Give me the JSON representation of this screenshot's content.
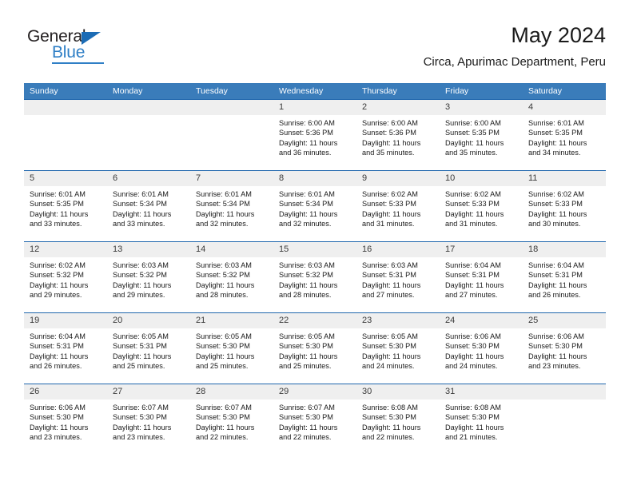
{
  "brand": {
    "name_top": "General",
    "name_bottom": "Blue",
    "triangle_color": "#1c6cb5",
    "blue_color": "#2f7fc6"
  },
  "header": {
    "title": "May 2024",
    "subtitle": "Circa, Apurimac Department, Peru"
  },
  "calendar": {
    "header_bg": "#3a7cba",
    "row_border_color": "#1f66ad",
    "date_band_bg": "#efefef",
    "weekdays": [
      "Sunday",
      "Monday",
      "Tuesday",
      "Wednesday",
      "Thursday",
      "Friday",
      "Saturday"
    ],
    "weeks": [
      [
        {
          "date": "",
          "lines": []
        },
        {
          "date": "",
          "lines": []
        },
        {
          "date": "",
          "lines": []
        },
        {
          "date": "1",
          "lines": [
            "Sunrise: 6:00 AM",
            "Sunset: 5:36 PM",
            "Daylight: 11 hours",
            "and 36 minutes."
          ]
        },
        {
          "date": "2",
          "lines": [
            "Sunrise: 6:00 AM",
            "Sunset: 5:36 PM",
            "Daylight: 11 hours",
            "and 35 minutes."
          ]
        },
        {
          "date": "3",
          "lines": [
            "Sunrise: 6:00 AM",
            "Sunset: 5:35 PM",
            "Daylight: 11 hours",
            "and 35 minutes."
          ]
        },
        {
          "date": "4",
          "lines": [
            "Sunrise: 6:01 AM",
            "Sunset: 5:35 PM",
            "Daylight: 11 hours",
            "and 34 minutes."
          ]
        }
      ],
      [
        {
          "date": "5",
          "lines": [
            "Sunrise: 6:01 AM",
            "Sunset: 5:35 PM",
            "Daylight: 11 hours",
            "and 33 minutes."
          ]
        },
        {
          "date": "6",
          "lines": [
            "Sunrise: 6:01 AM",
            "Sunset: 5:34 PM",
            "Daylight: 11 hours",
            "and 33 minutes."
          ]
        },
        {
          "date": "7",
          "lines": [
            "Sunrise: 6:01 AM",
            "Sunset: 5:34 PM",
            "Daylight: 11 hours",
            "and 32 minutes."
          ]
        },
        {
          "date": "8",
          "lines": [
            "Sunrise: 6:01 AM",
            "Sunset: 5:34 PM",
            "Daylight: 11 hours",
            "and 32 minutes."
          ]
        },
        {
          "date": "9",
          "lines": [
            "Sunrise: 6:02 AM",
            "Sunset: 5:33 PM",
            "Daylight: 11 hours",
            "and 31 minutes."
          ]
        },
        {
          "date": "10",
          "lines": [
            "Sunrise: 6:02 AM",
            "Sunset: 5:33 PM",
            "Daylight: 11 hours",
            "and 31 minutes."
          ]
        },
        {
          "date": "11",
          "lines": [
            "Sunrise: 6:02 AM",
            "Sunset: 5:33 PM",
            "Daylight: 11 hours",
            "and 30 minutes."
          ]
        }
      ],
      [
        {
          "date": "12",
          "lines": [
            "Sunrise: 6:02 AM",
            "Sunset: 5:32 PM",
            "Daylight: 11 hours",
            "and 29 minutes."
          ]
        },
        {
          "date": "13",
          "lines": [
            "Sunrise: 6:03 AM",
            "Sunset: 5:32 PM",
            "Daylight: 11 hours",
            "and 29 minutes."
          ]
        },
        {
          "date": "14",
          "lines": [
            "Sunrise: 6:03 AM",
            "Sunset: 5:32 PM",
            "Daylight: 11 hours",
            "and 28 minutes."
          ]
        },
        {
          "date": "15",
          "lines": [
            "Sunrise: 6:03 AM",
            "Sunset: 5:32 PM",
            "Daylight: 11 hours",
            "and 28 minutes."
          ]
        },
        {
          "date": "16",
          "lines": [
            "Sunrise: 6:03 AM",
            "Sunset: 5:31 PM",
            "Daylight: 11 hours",
            "and 27 minutes."
          ]
        },
        {
          "date": "17",
          "lines": [
            "Sunrise: 6:04 AM",
            "Sunset: 5:31 PM",
            "Daylight: 11 hours",
            "and 27 minutes."
          ]
        },
        {
          "date": "18",
          "lines": [
            "Sunrise: 6:04 AM",
            "Sunset: 5:31 PM",
            "Daylight: 11 hours",
            "and 26 minutes."
          ]
        }
      ],
      [
        {
          "date": "19",
          "lines": [
            "Sunrise: 6:04 AM",
            "Sunset: 5:31 PM",
            "Daylight: 11 hours",
            "and 26 minutes."
          ]
        },
        {
          "date": "20",
          "lines": [
            "Sunrise: 6:05 AM",
            "Sunset: 5:31 PM",
            "Daylight: 11 hours",
            "and 25 minutes."
          ]
        },
        {
          "date": "21",
          "lines": [
            "Sunrise: 6:05 AM",
            "Sunset: 5:30 PM",
            "Daylight: 11 hours",
            "and 25 minutes."
          ]
        },
        {
          "date": "22",
          "lines": [
            "Sunrise: 6:05 AM",
            "Sunset: 5:30 PM",
            "Daylight: 11 hours",
            "and 25 minutes."
          ]
        },
        {
          "date": "23",
          "lines": [
            "Sunrise: 6:05 AM",
            "Sunset: 5:30 PM",
            "Daylight: 11 hours",
            "and 24 minutes."
          ]
        },
        {
          "date": "24",
          "lines": [
            "Sunrise: 6:06 AM",
            "Sunset: 5:30 PM",
            "Daylight: 11 hours",
            "and 24 minutes."
          ]
        },
        {
          "date": "25",
          "lines": [
            "Sunrise: 6:06 AM",
            "Sunset: 5:30 PM",
            "Daylight: 11 hours",
            "and 23 minutes."
          ]
        }
      ],
      [
        {
          "date": "26",
          "lines": [
            "Sunrise: 6:06 AM",
            "Sunset: 5:30 PM",
            "Daylight: 11 hours",
            "and 23 minutes."
          ]
        },
        {
          "date": "27",
          "lines": [
            "Sunrise: 6:07 AM",
            "Sunset: 5:30 PM",
            "Daylight: 11 hours",
            "and 23 minutes."
          ]
        },
        {
          "date": "28",
          "lines": [
            "Sunrise: 6:07 AM",
            "Sunset: 5:30 PM",
            "Daylight: 11 hours",
            "and 22 minutes."
          ]
        },
        {
          "date": "29",
          "lines": [
            "Sunrise: 6:07 AM",
            "Sunset: 5:30 PM",
            "Daylight: 11 hours",
            "and 22 minutes."
          ]
        },
        {
          "date": "30",
          "lines": [
            "Sunrise: 6:08 AM",
            "Sunset: 5:30 PM",
            "Daylight: 11 hours",
            "and 22 minutes."
          ]
        },
        {
          "date": "31",
          "lines": [
            "Sunrise: 6:08 AM",
            "Sunset: 5:30 PM",
            "Daylight: 11 hours",
            "and 21 minutes."
          ]
        },
        {
          "date": "",
          "lines": []
        }
      ]
    ]
  }
}
